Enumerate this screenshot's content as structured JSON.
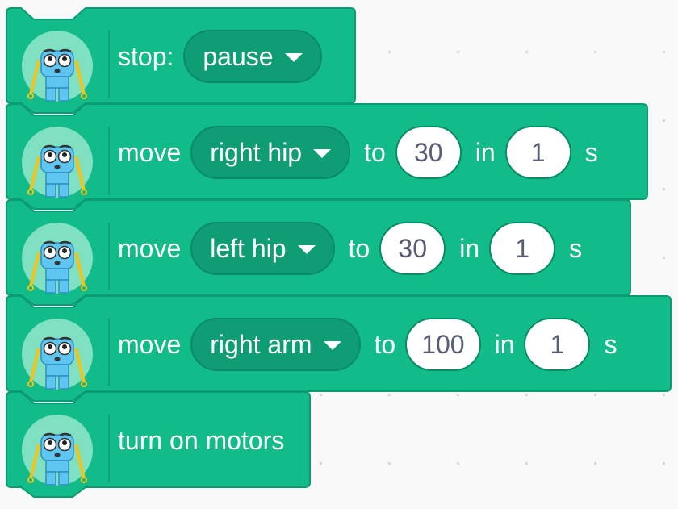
{
  "colors": {
    "block_fill": "#12bc8a",
    "block_stroke": "#0b9a71",
    "dropdown_fill": "#0f9d75",
    "canvas": "#f9f9f9"
  },
  "icon_name": "robot-avatar-icon",
  "blocks": [
    {
      "id": "stop",
      "parts": {
        "w1": "stop:"
      },
      "dropdown": "pause"
    },
    {
      "id": "move-right-hip",
      "parts": {
        "w1": "move",
        "w2": "to",
        "w3": "in",
        "w4": "s"
      },
      "dropdown": "right hip",
      "value": "30",
      "duration": "1"
    },
    {
      "id": "move-left-hip",
      "parts": {
        "w1": "move",
        "w2": "to",
        "w3": "in",
        "w4": "s"
      },
      "dropdown": "left hip",
      "value": "30",
      "duration": "1"
    },
    {
      "id": "move-right-arm",
      "parts": {
        "w1": "move",
        "w2": "to",
        "w3": "in",
        "w4": "s"
      },
      "dropdown": "right arm",
      "value": "100",
      "duration": "1"
    },
    {
      "id": "turn-on-motors",
      "parts": {
        "w1": "turn on motors"
      }
    }
  ]
}
